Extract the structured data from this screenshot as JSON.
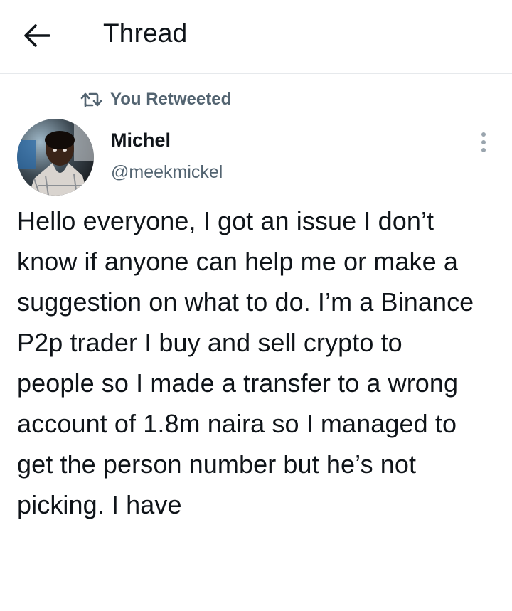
{
  "header": {
    "title": "Thread"
  },
  "retweet": {
    "label": "You Retweeted"
  },
  "author": {
    "name": "Michel",
    "handle": "@meekmickel"
  },
  "tweet": {
    "text": "Hello everyone, I got an issue I don’t know if anyone can help me or make a suggestion on what to do. I’m a Binance P2p trader I buy and sell crypto to people so I made a transfer to a wrong account of 1.8m naira so I managed to get the person number but he’s not picking. I have"
  },
  "colors": {
    "text_primary": "#0f1419",
    "text_secondary": "#536471",
    "divider": "#e6e9ec",
    "background": "#ffffff"
  },
  "icons": {
    "back": "arrow-left-icon",
    "retweet": "retweet-icon",
    "more": "more-vertical-icon"
  }
}
